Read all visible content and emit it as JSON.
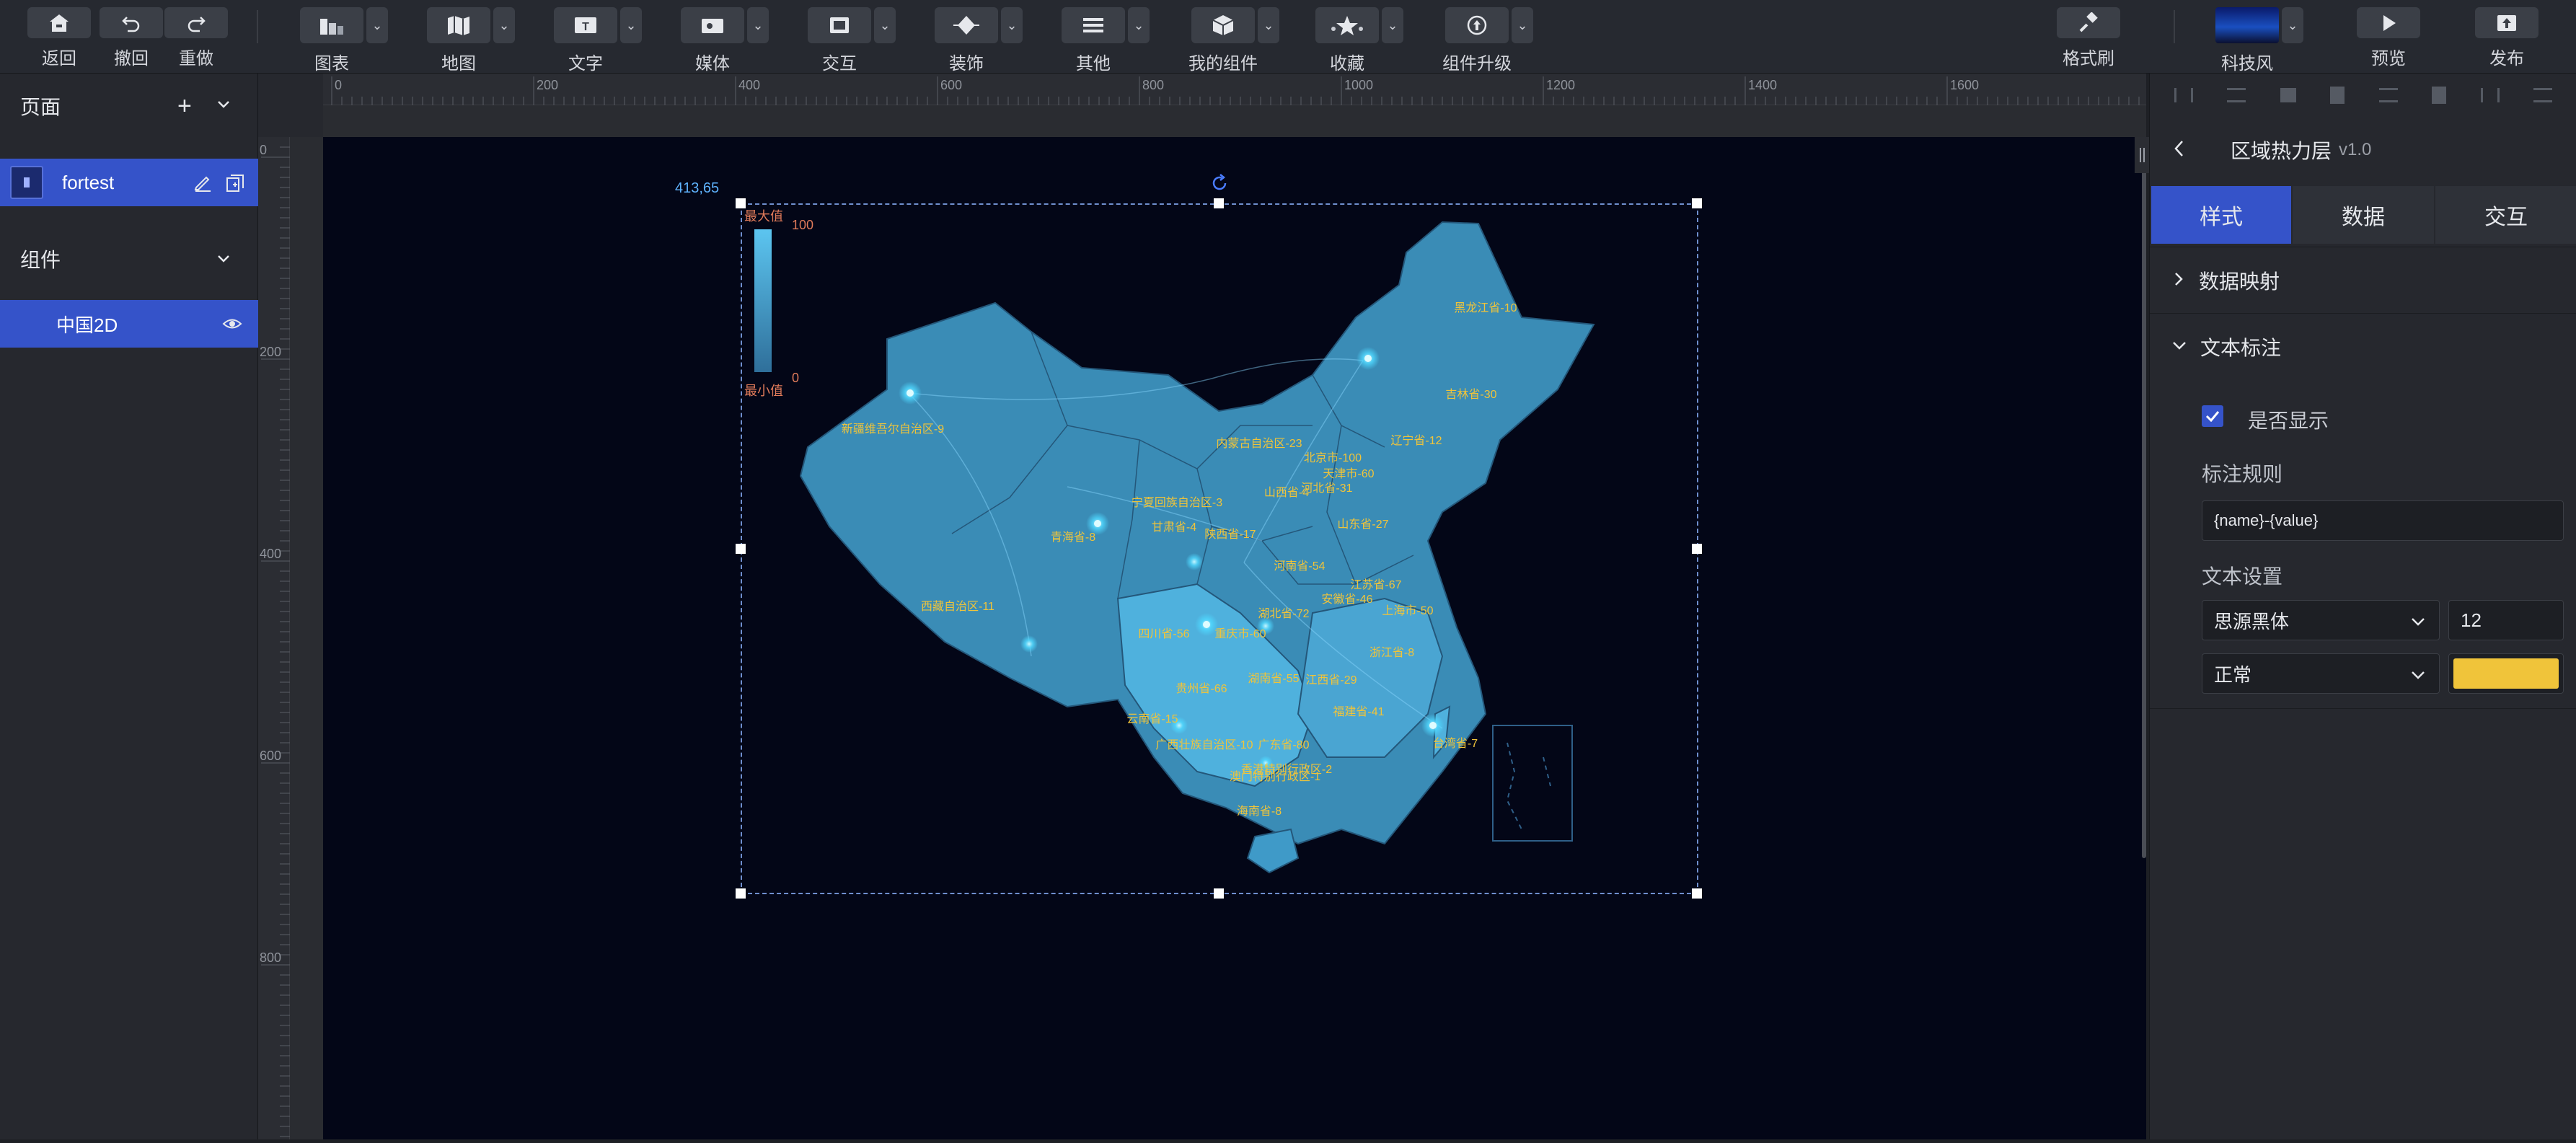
{
  "toolbar": {
    "back": "返回",
    "undo": "撤回",
    "redo": "重做",
    "chart": "图表",
    "map": "地图",
    "text": "文字",
    "media": "媒体",
    "interaction": "交互",
    "decoration": "装饰",
    "other": "其他",
    "my_components": "我的组件",
    "favorites": "收藏",
    "component_upgrade": "组件升级",
    "format_brush": "格式刷",
    "theme": "科技风",
    "preview": "预览",
    "publish": "发布"
  },
  "left_panel": {
    "pages_title": "页面",
    "page_name": "fortest",
    "components_title": "组件",
    "component_name": "中国2D"
  },
  "ruler": {
    "top_ticks": [
      "0",
      "200",
      "400",
      "600",
      "800",
      "1000",
      "1200",
      "1400",
      "1600"
    ],
    "left_ticks": [
      "0",
      "200",
      "400",
      "600",
      "800"
    ]
  },
  "canvas": {
    "selection_coords": "413,65",
    "legend_max_label": "最大值",
    "legend_min_label": "最小值",
    "legend_max_value": "100",
    "legend_min_value": "0"
  },
  "map_labels": [
    "黑龙江省-10",
    "吉林省-30",
    "辽宁省-12",
    "内蒙古自治区-23",
    "北京市-100",
    "天津市-60",
    "河北省-31",
    "山西省-4",
    "山东省-27",
    "新疆维吾尔自治区-9",
    "宁夏回族自治区-3",
    "甘肃省-4",
    "陕西省-17",
    "青海省-8",
    "河南省-54",
    "江苏省-67",
    "安徽省-46",
    "上海市-50",
    "湖北省-72",
    "西藏自治区-11",
    "四川省-56",
    "重庆市-60",
    "浙江省-8",
    "湖南省-55",
    "江西省-29",
    "贵州省-66",
    "福建省-41",
    "云南省-15",
    "台湾省-7",
    "广西壮族自治区-10",
    "广东省-80",
    "香港特别行政区-2",
    "澳门特别行政区-1",
    "海南省-8"
  ],
  "right_panel": {
    "title": "区域热力层",
    "version": "v1.0",
    "tabs": [
      "样式",
      "数据",
      "交互"
    ],
    "section_data_mapping": "数据映射",
    "section_text_label": "文本标注",
    "show_checkbox_label": "是否显示",
    "label_rule_title": "标注规则",
    "label_rule_value": "{name}-{value}",
    "text_settings_title": "文本设置",
    "font_family_value": "思源黑体",
    "font_size_value": "12",
    "font_weight_value": "正常",
    "text_color": "#f0c43a"
  },
  "colors": {
    "accent": "#3553c9",
    "stage_bg": "#030617",
    "map_fill": "#3a8cb6"
  }
}
